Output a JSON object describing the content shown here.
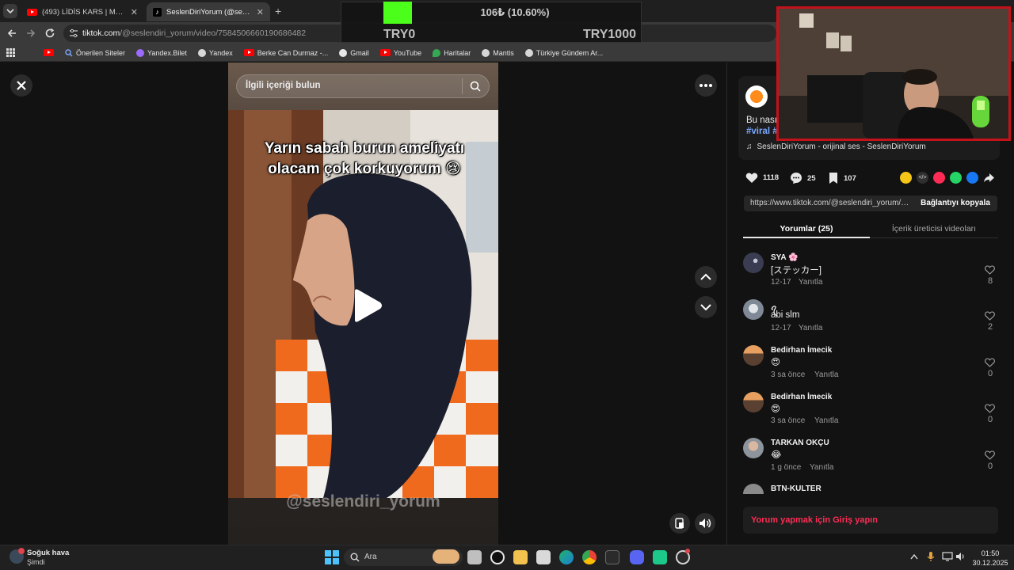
{
  "browser": {
    "tabs": [
      {
        "title": "(493) LİDİS KARS | Madara Old...",
        "active": false
      },
      {
        "title": "SeslenDiriYorum (@seslendiri_y...",
        "active": true
      }
    ],
    "new_tab_icon": "+",
    "url_host": "tiktok.com",
    "url_path": "/@seslendiri_yorum/video/7584506660190686482",
    "bookmarks": [
      {
        "label": "",
        "icon": "youtube-icon"
      },
      {
        "label": "Önerilen Siteler",
        "icon": "search-icon"
      },
      {
        "label": "Yandex.Bilet",
        "icon": "yandex-bilet-icon"
      },
      {
        "label": "Yandex",
        "icon": "globe-icon"
      },
      {
        "label": "Berke Can Durmaz -...",
        "icon": "youtube-icon"
      },
      {
        "label": "Gmail",
        "icon": "gmail-icon"
      },
      {
        "label": "YouTube",
        "icon": "youtube-icon"
      },
      {
        "label": "Haritalar",
        "icon": "maps-icon"
      },
      {
        "label": "Mantis",
        "icon": "globe-icon"
      },
      {
        "label": "Türkiye Gündem Ar...",
        "icon": "globe-icon"
      }
    ]
  },
  "overlay": {
    "goal_text": "106₺ (10.60%)",
    "goal_fraction": 0.106,
    "goal_min": "TRY0",
    "goal_max": "TRY1000"
  },
  "video": {
    "search_placeholder": "İlgili içeriği bulun",
    "caption_line1": "Yarın sabah burun ameliyatı",
    "caption_line2": "olacam çok korkuyorum 😢",
    "watermark": "@seslendiri_yorum"
  },
  "post": {
    "description": "Bu nasıl",
    "tags": "#viral #",
    "sound": "SeslenDiriYorum - orijinal ses - SeslenDiriYorum",
    "likes": "1118",
    "comments": "25",
    "saves": "107",
    "link_url": "https://www.tiktok.com/@seslendiri_yorum/vi...",
    "copy_link_label": "Bağlantıyı kopyala",
    "tab_comments": "Yorumlar (25)",
    "tab_creator": "İçerik üreticisi videoları"
  },
  "comments": [
    {
      "name": "SYA 🌸",
      "text": "[ステッカー]",
      "date": "12-17",
      "reply": "Yanıtla",
      "likes": "8",
      "avatar_color": "#3a3d52"
    },
    {
      "name": "ꪖ",
      "text": "abi slm",
      "date": "12-17",
      "reply": "Yanıtla",
      "likes": "2",
      "avatar_color": "#8f9aa6"
    },
    {
      "name": "Bedirhan İmecik",
      "text": "😍",
      "date": "3 sa önce",
      "reply": "Yanıtla",
      "likes": "0",
      "avatar_color": "#d08a4a"
    },
    {
      "name": "Bedirhan İmecik",
      "text": "😍",
      "date": "3 sa önce",
      "reply": "Yanıtla",
      "likes": "0",
      "avatar_color": "#d08a4a"
    },
    {
      "name": "TARKAN OKÇU",
      "text": "😂",
      "date": "1 g önce",
      "reply": "Yanıtla",
      "likes": "0",
      "avatar_color": "#9aa0a8"
    },
    {
      "name": "BTN-KULTER",
      "text": "",
      "date": "",
      "reply": "",
      "likes": "",
      "avatar_color": "#8a8a8a"
    }
  ],
  "login_prompt": "Yorum yapmak için Giriş yapın",
  "taskbar": {
    "weather_title": "Soğuk hava",
    "weather_sub": "Şimdi",
    "search_label": "Ara",
    "time": "01:50",
    "date": "30.12.2025"
  },
  "colors": {
    "accent_red": "#fe2c55",
    "goal_green": "#4cff1a",
    "webcam_border": "#c4121a",
    "tag_blue": "#7aa8ff"
  }
}
